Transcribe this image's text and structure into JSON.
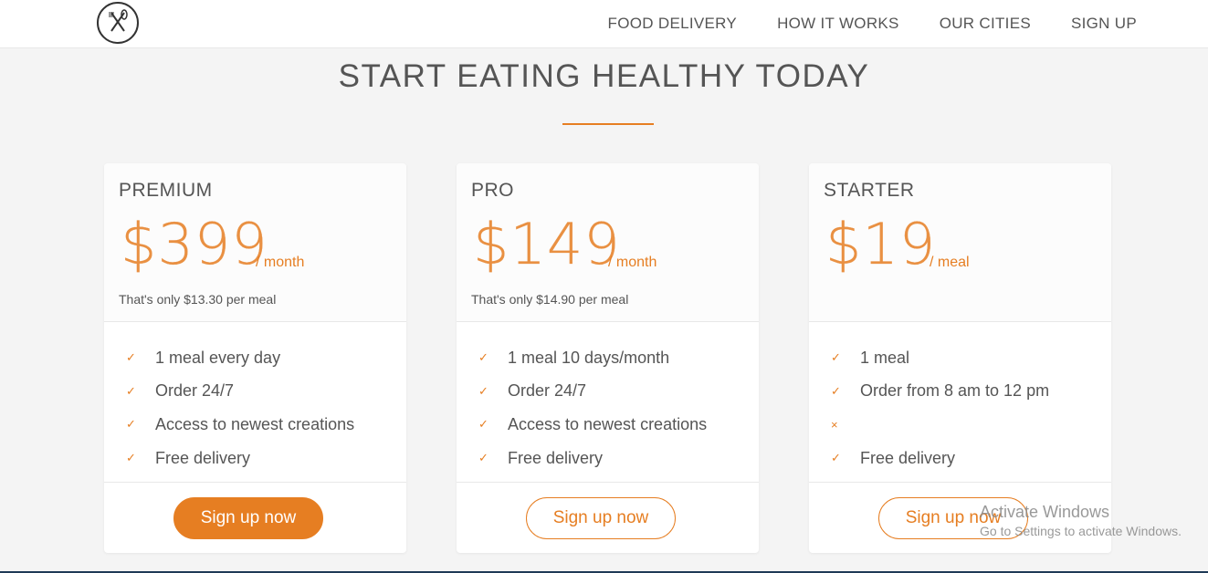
{
  "nav": {
    "items": [
      "FOOD DELIVERY",
      "HOW IT WORKS",
      "OUR CITIES",
      "SIGN UP"
    ]
  },
  "section": {
    "title": "START EATING HEALTHY TODAY"
  },
  "plans": [
    {
      "name": "PREMIUM",
      "price": "$399",
      "unit": "/ month",
      "note": "That's only $13.30 per meal",
      "features": [
        {
          "mark": "✓",
          "text": "1 meal every day"
        },
        {
          "mark": "✓",
          "text": "Order 24/7"
        },
        {
          "mark": "✓",
          "text": "Access to newest creations"
        },
        {
          "mark": "✓",
          "text": "Free delivery"
        }
      ],
      "button": "Sign up now"
    },
    {
      "name": "PRO",
      "price": "$149",
      "unit": "/ month",
      "note": "That's only $14.90 per meal",
      "features": [
        {
          "mark": "✓",
          "text": "1 meal 10 days/month"
        },
        {
          "mark": "✓",
          "text": "Order 24/7"
        },
        {
          "mark": "✓",
          "text": "Access to newest creations"
        },
        {
          "mark": "✓",
          "text": "Free delivery"
        }
      ],
      "button": "Sign up now"
    },
    {
      "name": "STARTER",
      "price": "$19",
      "unit": "/ meal",
      "note": "",
      "features": [
        {
          "mark": "✓",
          "text": "1 meal"
        },
        {
          "mark": "✓",
          "text": "Order from 8 am to 12 pm"
        },
        {
          "mark": "×",
          "text": ""
        },
        {
          "mark": "✓",
          "text": "Free delivery"
        }
      ],
      "button": "Sign up now"
    }
  ],
  "watermark": {
    "line1": "Activate Windows",
    "line2": "Go to Settings to activate Windows."
  },
  "colors": {
    "accent": "#e67e22",
    "background": "#f4f4f4"
  }
}
